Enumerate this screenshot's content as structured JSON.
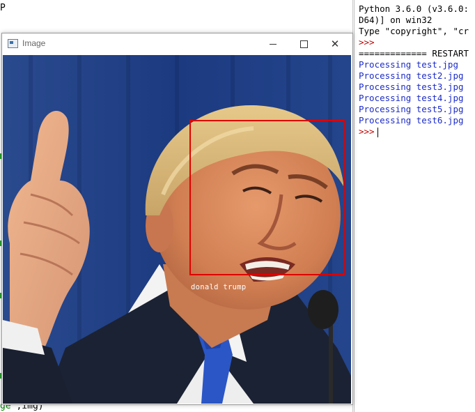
{
  "editor": {
    "top_glyph": "P",
    "bottom_code_prefix": "ge'",
    "bottom_code_suffix": ",img)"
  },
  "shell": {
    "lines": [
      {
        "text": "Python 3.6.0 (v3.6.0:",
        "kind": "black"
      },
      {
        "text": "D64)] on win32",
        "kind": "black"
      },
      {
        "text": "Type \"copyright\", \"cr",
        "kind": "black"
      },
      {
        "text": ">>>",
        "kind": "prompt"
      },
      {
        "text": "============= RESTART",
        "kind": "black"
      },
      {
        "text": "Processing test.jpg",
        "kind": "out"
      },
      {
        "text": "Processing test2.jpg",
        "kind": "out"
      },
      {
        "text": "Processing test3.jpg",
        "kind": "out"
      },
      {
        "text": "Processing test4.jpg",
        "kind": "out"
      },
      {
        "text": "Processing test5.jpg",
        "kind": "out"
      },
      {
        "text": "Processing test6.jpg",
        "kind": "out"
      },
      {
        "text": ">>>",
        "kind": "prompt"
      }
    ]
  },
  "image_window": {
    "title": "Image",
    "minimize_icon": "minimize-icon",
    "maximize_icon": "maximize-icon",
    "close_icon": "close-icon",
    "detection_label": "donald trump",
    "box_color": "#e00000"
  }
}
